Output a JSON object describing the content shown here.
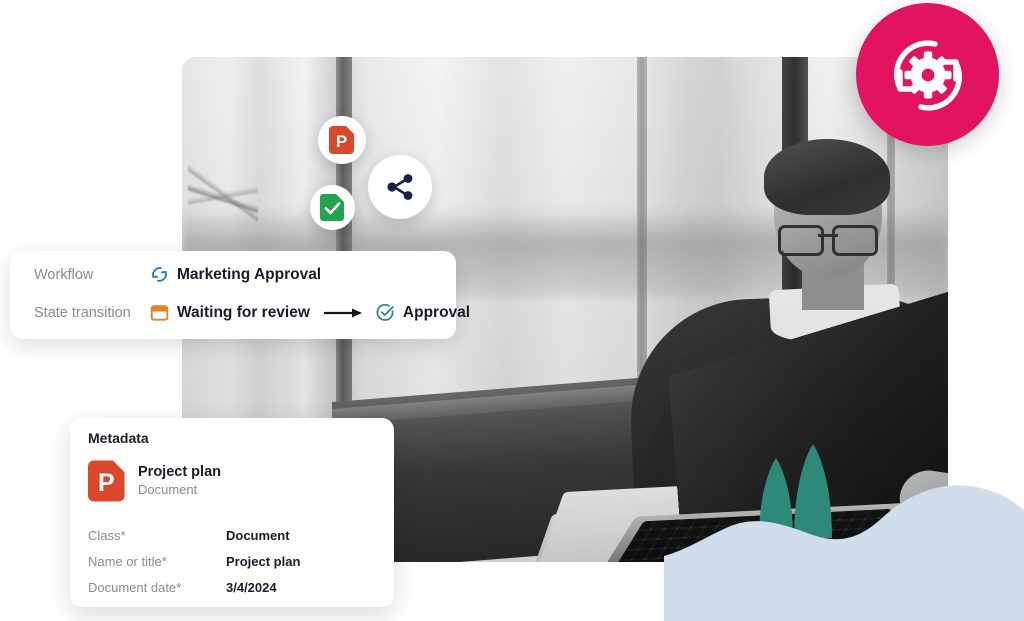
{
  "theme": {
    "badge_pink": "#e3145f",
    "accent_blue": "#1e7fd4",
    "accent_orange": "#e8821e",
    "accent_teal": "#2f8f7a",
    "accent_green": "#22a44e",
    "accent_red": "#d9482a",
    "navy": "#1b1f4b",
    "blob_blue": "#cfdeea",
    "tree_teal": "#2e8a78",
    "text_dark": "#1c1c28",
    "text_muted": "#8b8b90"
  },
  "hero": {
    "photo_alt": "Man with glasses working at a laptop in an office",
    "gear_badge_icon": "sync-gear-icon"
  },
  "floating_icons": [
    {
      "name": "powerpoint-icon",
      "letter": "P",
      "color": "#d9482a"
    },
    {
      "name": "approved-document-icon",
      "color": "#22a44e"
    },
    {
      "name": "share-icon",
      "color": "#1b1f4b"
    }
  ],
  "workflow_card": {
    "rows": [
      {
        "label": "Workflow",
        "icon": "sync-icon",
        "value": "Marketing Approval"
      },
      {
        "label": "State transition",
        "from_icon": "calendar-icon",
        "from_value": "Waiting for review",
        "arrow_icon": "arrow-right-icon",
        "to_icon": "check-circle-icon",
        "to_value": "Approval"
      }
    ]
  },
  "metadata_card": {
    "title": "Metadata",
    "document": {
      "icon": "powerpoint-icon",
      "icon_letter": "P",
      "name": "Project plan",
      "type": "Document"
    },
    "fields": [
      {
        "key": "Class*",
        "value": "Document"
      },
      {
        "key": "Name or title*",
        "value": "Project plan"
      },
      {
        "key": "Document date*",
        "value": "3/4/2024"
      }
    ]
  }
}
